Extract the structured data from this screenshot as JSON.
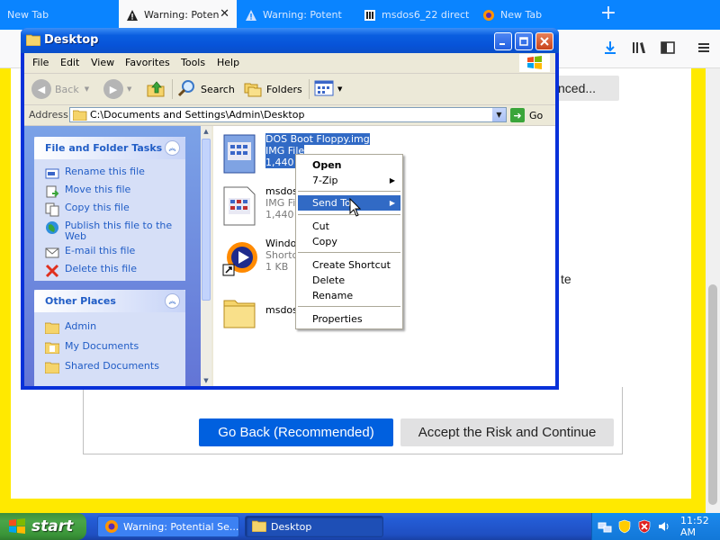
{
  "firefox": {
    "tabs": [
      {
        "label": "New Tab",
        "icon": "none",
        "active": false
      },
      {
        "label": "Warning: Poten",
        "icon": "warning-icon",
        "active": true
      },
      {
        "label": "Warning: Potent",
        "icon": "warning-icon",
        "active": false
      },
      {
        "label": "msdos6_22 direct",
        "icon": "archive-icon",
        "active": false
      },
      {
        "label": "New Tab",
        "icon": "firefox-icon",
        "active": false
      }
    ],
    "toolbar_icons": [
      "download-icon",
      "library-icon",
      "sidebar-icon",
      "menu-icon"
    ],
    "page": {
      "advanced_button_fragment": "nced...",
      "background_text_fragment": "te",
      "go_back_button": "Go Back (Recommended)",
      "accept_button": "Accept the Risk and Continue"
    }
  },
  "explorer": {
    "title": "Desktop",
    "menu": [
      "File",
      "Edit",
      "View",
      "Favorites",
      "Tools",
      "Help"
    ],
    "toolbar": {
      "back": "Back",
      "search": "Search",
      "folders": "Folders"
    },
    "address": {
      "label": "Address",
      "path": "C:\\Documents and Settings\\Admin\\Desktop",
      "go": "Go"
    },
    "tasks": {
      "file_folder": {
        "title": "File and Folder Tasks",
        "items": [
          "Rename this file",
          "Move this file",
          "Copy this file",
          "Publish this file to the Web",
          "E-mail this file",
          "Delete this file"
        ]
      },
      "other_places": {
        "title": "Other Places",
        "items": [
          "Admin",
          "My Documents",
          "Shared Documents"
        ]
      }
    },
    "files": [
      {
        "name": "DOS Boot Floppy.img",
        "type": "IMG File",
        "size": "1,440 K",
        "selected": true
      },
      {
        "name": "msdos6",
        "type": "IMG File",
        "size": "1,440 K",
        "selected": false
      },
      {
        "name": "Window",
        "type": "Shortcu",
        "size": "1 KB",
        "selected": false
      },
      {
        "name": "msdos6",
        "type": "",
        "size": "",
        "selected": false
      }
    ]
  },
  "context_menu": {
    "items": [
      {
        "label": "Open",
        "bold": true
      },
      {
        "label": "7-Zip",
        "submenu": true
      },
      {
        "label": "Send To",
        "submenu": true,
        "highlighted": true
      },
      {
        "label": "Cut"
      },
      {
        "label": "Copy"
      },
      {
        "label": "Create Shortcut"
      },
      {
        "label": "Delete"
      },
      {
        "label": "Rename"
      },
      {
        "label": "Properties"
      }
    ]
  },
  "taskbar": {
    "start": "start",
    "buttons": [
      {
        "label": "Warning: Potential Se...",
        "icon": "firefox-icon"
      },
      {
        "label": "Desktop",
        "icon": "folder-icon"
      }
    ],
    "clock": "11:52 AM"
  },
  "colors": {
    "firefox_blue": "#0a84ff",
    "warning_yellow": "#ffe900",
    "primary_button": "#0060df",
    "xp_titlebar": "#0a5ee0",
    "selection": "#316ac5"
  }
}
